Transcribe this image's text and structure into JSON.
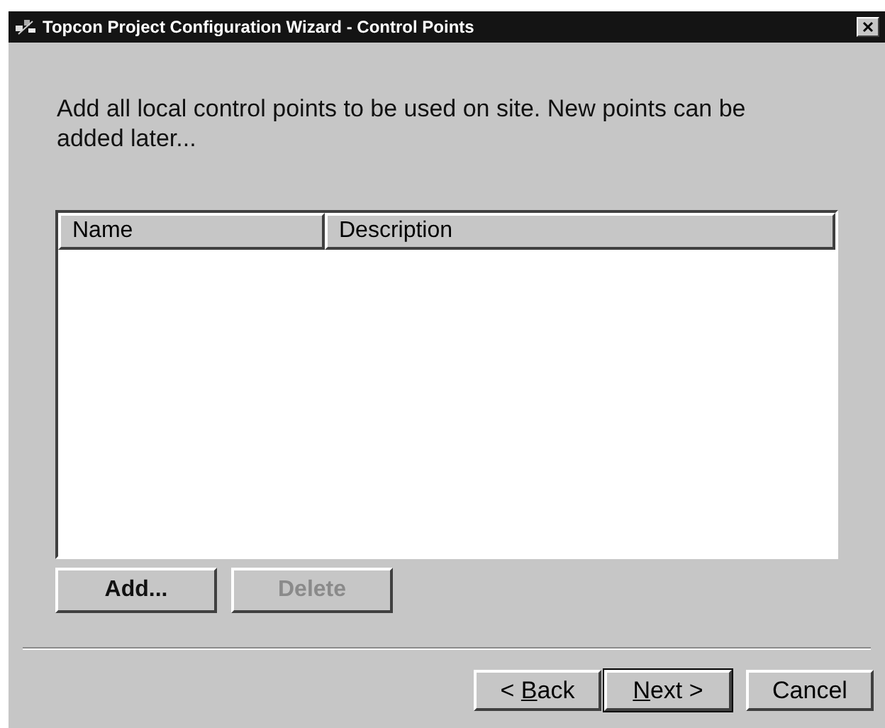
{
  "window": {
    "title": "Topcon Project Configuration Wizard - Control Points"
  },
  "instructions": "Add all local control points to be used on site. New points can be added later...",
  "list": {
    "columns": [
      "Name",
      "Description"
    ]
  },
  "list_buttons": [
    {
      "label": "Add...",
      "disabled": false
    },
    {
      "label": "Delete",
      "disabled": true
    }
  ],
  "nav_buttons": [
    {
      "before": "< ",
      "key": "B",
      "after": "ack",
      "default": false
    },
    {
      "key": "N",
      "after": "ext >",
      "default": true
    },
    {
      "before": "Cancel",
      "default": false
    }
  ]
}
